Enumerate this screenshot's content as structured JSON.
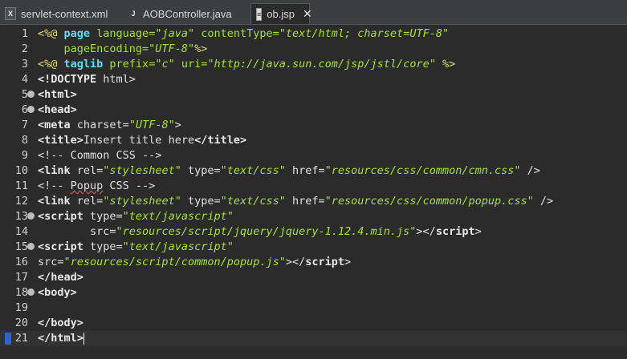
{
  "tabs": [
    {
      "label": "servlet-context.xml",
      "icon": "xml-file-icon",
      "active": false
    },
    {
      "label": "AOBController.java",
      "icon": "java-file-icon",
      "active": false
    },
    {
      "label": "ob.jsp",
      "icon": "jsp-file-icon",
      "active": true
    }
  ],
  "close_glyph": "✕",
  "lines": [
    {
      "n": "1",
      "fold": false,
      "parts": [
        [
          "d",
          "<%@ "
        ],
        [
          "k",
          "page "
        ],
        [
          "a",
          "language="
        ],
        [
          "s",
          "\"java\" "
        ],
        [
          "a",
          "contentType="
        ],
        [
          "s",
          "\"text/html; charset=UTF-8\""
        ]
      ]
    },
    {
      "n": "2",
      "fold": false,
      "parts": [
        [
          "a",
          "    pageEncoding="
        ],
        [
          "s",
          "\"UTF-8\""
        ],
        [
          "d",
          "%>"
        ]
      ]
    },
    {
      "n": "3",
      "fold": false,
      "parts": [
        [
          "d",
          "<%@ "
        ],
        [
          "k",
          "taglib "
        ],
        [
          "a",
          "prefix="
        ],
        [
          "s",
          "\"c\" "
        ],
        [
          "a",
          "uri="
        ],
        [
          "s",
          "\"http://java.sun.com/jsp/jstl/core\" "
        ],
        [
          "d",
          "%>"
        ]
      ]
    },
    {
      "n": "4",
      "fold": false,
      "parts": [
        [
          "t",
          "<!DOCTYPE "
        ],
        [
          "g",
          "html>"
        ]
      ]
    },
    {
      "n": "5",
      "fold": true,
      "parts": [
        [
          "t",
          "<html>"
        ]
      ]
    },
    {
      "n": "6",
      "fold": true,
      "parts": [
        [
          "t",
          "<head>"
        ]
      ]
    },
    {
      "n": "7",
      "fold": false,
      "parts": [
        [
          "t",
          "<meta "
        ],
        [
          "g",
          "charset="
        ],
        [
          "s",
          "\"UTF-8\""
        ],
        [
          "g",
          ">"
        ]
      ]
    },
    {
      "n": "8",
      "fold": false,
      "parts": [
        [
          "t",
          "<title>"
        ],
        [
          "g",
          "Insert title here"
        ],
        [
          "t",
          "</title>"
        ]
      ]
    },
    {
      "n": "9",
      "fold": false,
      "parts": [
        [
          "c",
          "<!-- Common CSS -->"
        ]
      ]
    },
    {
      "n": "10",
      "fold": false,
      "parts": [
        [
          "t",
          "<link "
        ],
        [
          "g",
          "rel="
        ],
        [
          "s",
          "\"stylesheet\" "
        ],
        [
          "g",
          "type="
        ],
        [
          "s",
          "\"text/css\" "
        ],
        [
          "g",
          "href="
        ],
        [
          "s",
          "\"resources/css/common/cmn.css\" "
        ],
        [
          "g",
          "/>"
        ]
      ]
    },
    {
      "n": "11",
      "fold": false,
      "parts": [
        [
          "c",
          "<!-- "
        ],
        [
          "q",
          "Popup"
        ],
        [
          "c",
          " CSS -->"
        ]
      ]
    },
    {
      "n": "12",
      "fold": false,
      "parts": [
        [
          "t",
          "<link "
        ],
        [
          "g",
          "rel="
        ],
        [
          "s",
          "\"stylesheet\" "
        ],
        [
          "g",
          "type="
        ],
        [
          "s",
          "\"text/css\" "
        ],
        [
          "g",
          "href="
        ],
        [
          "s",
          "\"resources/css/common/popup.css\" "
        ],
        [
          "g",
          "/>"
        ]
      ]
    },
    {
      "n": "13",
      "fold": true,
      "parts": [
        [
          "t",
          "<script "
        ],
        [
          "g",
          "type="
        ],
        [
          "s",
          "\"text/javascript\""
        ]
      ]
    },
    {
      "n": "14",
      "fold": false,
      "parts": [
        [
          "g",
          "        src="
        ],
        [
          "s",
          "\"resources/script/jquery/jquery-1.12.4.min.js\""
        ],
        [
          "g",
          "></"
        ],
        [
          "t",
          "script"
        ],
        [
          "g",
          ">"
        ]
      ]
    },
    {
      "n": "15",
      "fold": true,
      "parts": [
        [
          "t",
          "<script "
        ],
        [
          "g",
          "type="
        ],
        [
          "s",
          "\"text/javascript\""
        ]
      ]
    },
    {
      "n": "16",
      "fold": false,
      "parts": [
        [
          "g",
          "src="
        ],
        [
          "s",
          "\"resources/script/common/popup.js\""
        ],
        [
          "g",
          "></"
        ],
        [
          "t",
          "script"
        ],
        [
          "g",
          ">"
        ]
      ]
    },
    {
      "n": "17",
      "fold": false,
      "parts": [
        [
          "t",
          "</head>"
        ]
      ]
    },
    {
      "n": "18",
      "fold": true,
      "parts": [
        [
          "t",
          "<body>"
        ]
      ]
    },
    {
      "n": "19",
      "fold": false,
      "parts": []
    },
    {
      "n": "20",
      "fold": false,
      "parts": [
        [
          "t",
          "</body>"
        ]
      ]
    },
    {
      "n": "21",
      "fold": false,
      "current": true,
      "parts": [
        [
          "t",
          "</html>"
        ]
      ]
    }
  ]
}
